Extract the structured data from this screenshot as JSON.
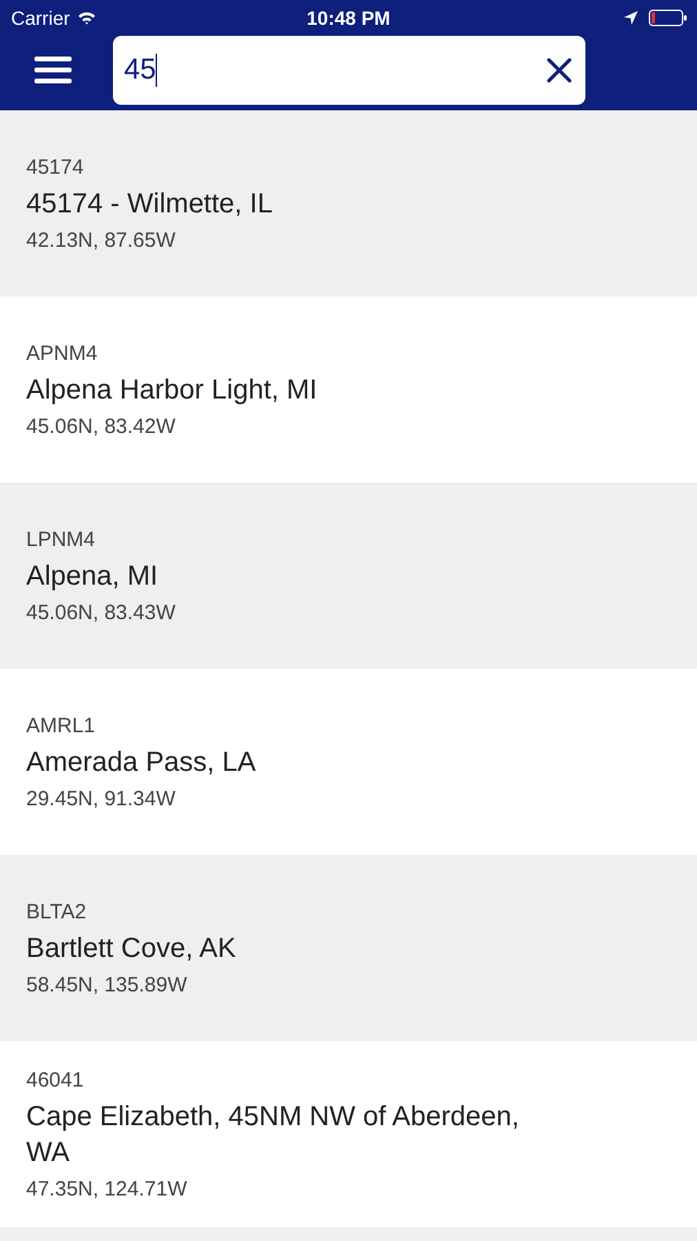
{
  "status_bar": {
    "carrier": "Carrier",
    "time": "10:48 PM"
  },
  "search": {
    "value": "45"
  },
  "results": [
    {
      "code": "45174",
      "name": "45174 - Wilmette, IL",
      "coords": "42.13N, 87.65W"
    },
    {
      "code": "APNM4",
      "name": "Alpena Harbor Light, MI",
      "coords": "45.06N, 83.42W"
    },
    {
      "code": "LPNM4",
      "name": "Alpena, MI",
      "coords": "45.06N, 83.43W"
    },
    {
      "code": "AMRL1",
      "name": "Amerada Pass, LA",
      "coords": "29.45N, 91.34W"
    },
    {
      "code": "BLTA2",
      "name": "Bartlett Cove, AK",
      "coords": "58.45N, 135.89W"
    },
    {
      "code": "46041",
      "name": "Cape Elizabeth, 45NM NW of Aberdeen, WA",
      "coords": "47.35N, 124.71W"
    }
  ]
}
